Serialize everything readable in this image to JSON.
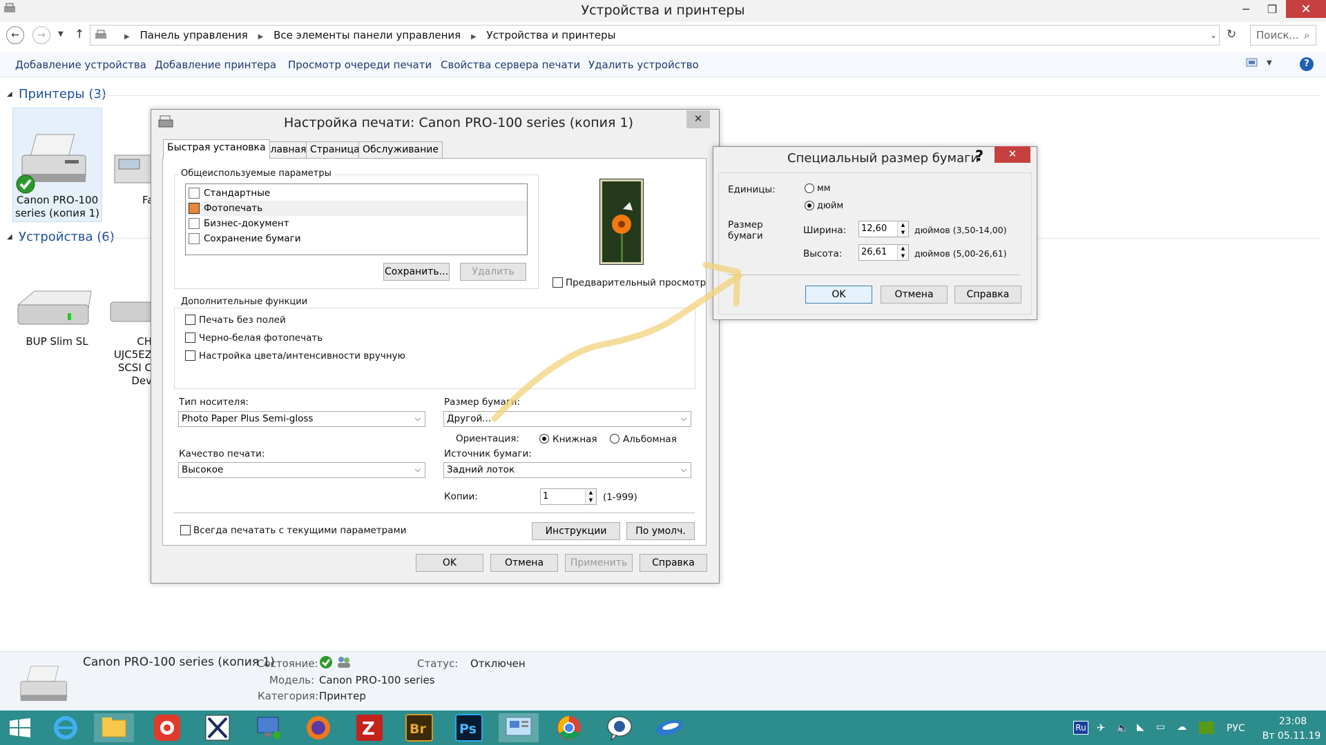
{
  "explorer": {
    "title": "Устройства и принтеры",
    "breadcrumb": [
      "Панель управления",
      "Все элементы панели управления",
      "Устройства и принтеры"
    ],
    "search_placeholder": "Поиск...",
    "toolbar": [
      "Добавление устройства",
      "Добавление принтера",
      "Просмотр очереди печати",
      "Свойства сервера печати",
      "Удалить устройство"
    ],
    "groups": {
      "printers": "Принтеры (3)",
      "devices": "Устройства (6)"
    },
    "printers": [
      {
        "label1": "Canon PRO-100",
        "label2": "series (копия 1)"
      },
      {
        "label1": "Fa"
      }
    ],
    "devices": [
      {
        "label1": "BUP Slim SL"
      },
      {
        "label1": "CH",
        "label2": "UJC5EZ",
        "label3": "SCSI C",
        "label4": "Dev"
      }
    ]
  },
  "details": {
    "name": "Canon PRO-100 series (копия 1)",
    "state_label": "Состояние:",
    "status_label": "Статус:",
    "status_value": "Отключен",
    "model_label": "Модель:",
    "model_value": "Canon PRO-100 series",
    "category_label": "Категория:",
    "category_value": "Принтер"
  },
  "print_dialog": {
    "title": "Настройка печати: Canon PRO-100 series (копия 1)",
    "tabs": [
      "Быстрая установка",
      "Главная",
      "Страница",
      "Обслуживание"
    ],
    "common_settings_label": "Общеиспользуемые параметры",
    "common_settings": [
      "Стандартные",
      "Фотопечать",
      "Бизнес-документ",
      "Сохранение бумаги"
    ],
    "selected_setting": "Фотопечать",
    "save_button": "Сохранить...",
    "delete_button": "Удалить",
    "preview_label": "Предварительный просмотр",
    "extra_label": "Дополнительные функции",
    "extra": [
      "Печать без полей",
      "Черно-белая фотопечать",
      "Настройка цвета/интенсивности вручную"
    ],
    "media_type_label": "Тип носителя:",
    "media_type_value": "Photo Paper Plus Semi-gloss",
    "paper_size_label": "Размер бумаги:",
    "paper_size_value": "Другой...",
    "orientation_label": "Ориентация:",
    "orientation_portrait": "Книжная",
    "orientation_landscape": "Альбомная",
    "quality_label": "Качество печати:",
    "quality_value": "Высокое",
    "source_label": "Источник бумаги:",
    "source_value": "Задний лоток",
    "copies_label": "Копии:",
    "copies_value": "1",
    "copies_range": "(1-999)",
    "always_print_label": "Всегда печатать с текущими параметрами",
    "instructions_button": "Инструкции",
    "defaults_button": "По умолч.",
    "ok": "OK",
    "cancel": "Отмена",
    "apply": "Применить",
    "help": "Справка"
  },
  "custom_dialog": {
    "title": "Специальный размер бумаги",
    "help_glyph": "?",
    "units_label": "Единицы:",
    "unit_mm": "мм",
    "unit_inch": "дюйм",
    "size_label1": "Размер",
    "size_label2": "бумаги",
    "width_label": "Ширина:",
    "width_value": "12,60",
    "width_range": "дюймов (3,50-14,00)",
    "height_label": "Высота:",
    "height_value": "26,61",
    "height_range": "дюймов (5,00-26,61)",
    "ok": "OK",
    "cancel": "Отмена",
    "help": "Справка"
  },
  "taskbar": {
    "lang": "РУС",
    "lang_badge": "Ru",
    "time": "23:08",
    "date": "Вт 05.11.19",
    "apps": [
      "internet-explorer-icon",
      "file-explorer-icon",
      "app-red-icon",
      "app-editor-icon",
      "network-pc-icon",
      "firefox-icon",
      "filezilla-icon",
      "bridge-icon",
      "photoshop-icon",
      "control-panel-icon",
      "chrome-icon",
      "chat-icon",
      "app-blue-icon"
    ],
    "accent": "#2d8c8c"
  }
}
